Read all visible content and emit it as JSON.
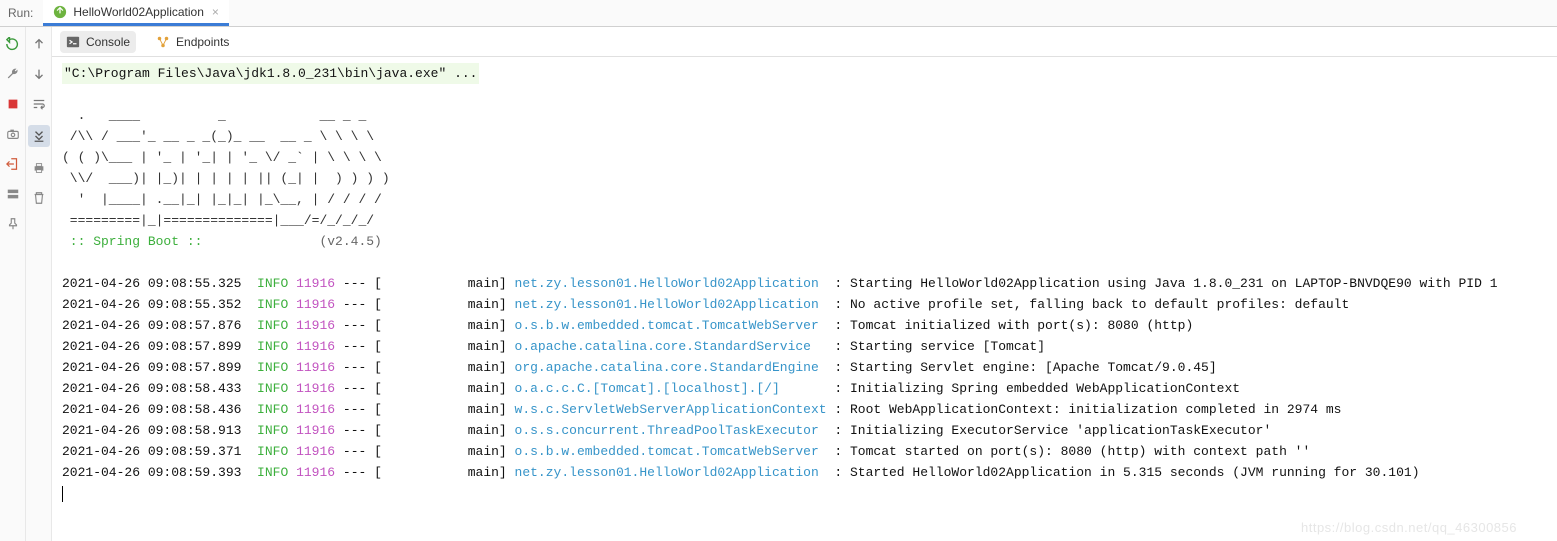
{
  "header": {
    "run_label": "Run:",
    "active_run_config": "HelloWorld02Application"
  },
  "subtabs": {
    "console": "Console",
    "endpoints": "Endpoints"
  },
  "console": {
    "command_line": "\"C:\\Program Files\\Java\\jdk1.8.0_231\\bin\\java.exe\" ...",
    "banner": "  .   ____          _            __ _ _\n /\\\\ / ___'_ __ _ _(_)_ __  __ _ \\ \\ \\ \\\n( ( )\\___ | '_ | '_| | '_ \\/ _` | \\ \\ \\ \\\n \\\\/  ___)| |_)| | | | | || (_| |  ) ) ) )\n  '  |____| .__|_| |_|_| |_\\__, | / / / /\n =========|_|==============|___/=/_/_/_/",
    "spring_label": " :: Spring Boot :: ",
    "spring_version": "(v2.4.5)",
    "logs": [
      {
        "ts": "2021-04-26 09:08:55.325",
        "level": "INFO",
        "pid": "11916",
        "sep": "--- [           main]",
        "logger": "net.zy.lesson01.HelloWorld02Application ",
        "msg": " : Starting HelloWorld02Application using Java 1.8.0_231 on LAPTOP-BNVDQE90 with PID 1"
      },
      {
        "ts": "2021-04-26 09:08:55.352",
        "level": "INFO",
        "pid": "11916",
        "sep": "--- [           main]",
        "logger": "net.zy.lesson01.HelloWorld02Application ",
        "msg": " : No active profile set, falling back to default profiles: default"
      },
      {
        "ts": "2021-04-26 09:08:57.876",
        "level": "INFO",
        "pid": "11916",
        "sep": "--- [           main]",
        "logger": "o.s.b.w.embedded.tomcat.TomcatWebServer ",
        "msg": " : Tomcat initialized with port(s): 8080 (http)"
      },
      {
        "ts": "2021-04-26 09:08:57.899",
        "level": "INFO",
        "pid": "11916",
        "sep": "--- [           main]",
        "logger": "o.apache.catalina.core.StandardService  ",
        "msg": " : Starting service [Tomcat]"
      },
      {
        "ts": "2021-04-26 09:08:57.899",
        "level": "INFO",
        "pid": "11916",
        "sep": "--- [           main]",
        "logger": "org.apache.catalina.core.StandardEngine ",
        "msg": " : Starting Servlet engine: [Apache Tomcat/9.0.45]"
      },
      {
        "ts": "2021-04-26 09:08:58.433",
        "level": "INFO",
        "pid": "11916",
        "sep": "--- [           main]",
        "logger": "o.a.c.c.C.[Tomcat].[localhost].[/]      ",
        "msg": " : Initializing Spring embedded WebApplicationContext"
      },
      {
        "ts": "2021-04-26 09:08:58.436",
        "level": "INFO",
        "pid": "11916",
        "sep": "--- [           main]",
        "logger": "w.s.c.ServletWebServerApplicationContext",
        "msg": " : Root WebApplicationContext: initialization completed in 2974 ms"
      },
      {
        "ts": "2021-04-26 09:08:58.913",
        "level": "INFO",
        "pid": "11916",
        "sep": "--- [           main]",
        "logger": "o.s.s.concurrent.ThreadPoolTaskExecutor ",
        "msg": " : Initializing ExecutorService 'applicationTaskExecutor'"
      },
      {
        "ts": "2021-04-26 09:08:59.371",
        "level": "INFO",
        "pid": "11916",
        "sep": "--- [           main]",
        "logger": "o.s.b.w.embedded.tomcat.TomcatWebServer ",
        "msg": " : Tomcat started on port(s): 8080 (http) with context path ''"
      },
      {
        "ts": "2021-04-26 09:08:59.393",
        "level": "INFO",
        "pid": "11916",
        "sep": "--- [           main]",
        "logger": "net.zy.lesson01.HelloWorld02Application ",
        "msg": " : Started HelloWorld02Application in 5.315 seconds (JVM running for 30.101)"
      }
    ]
  },
  "watermark": "https://blog.csdn.net/qq_46300856"
}
